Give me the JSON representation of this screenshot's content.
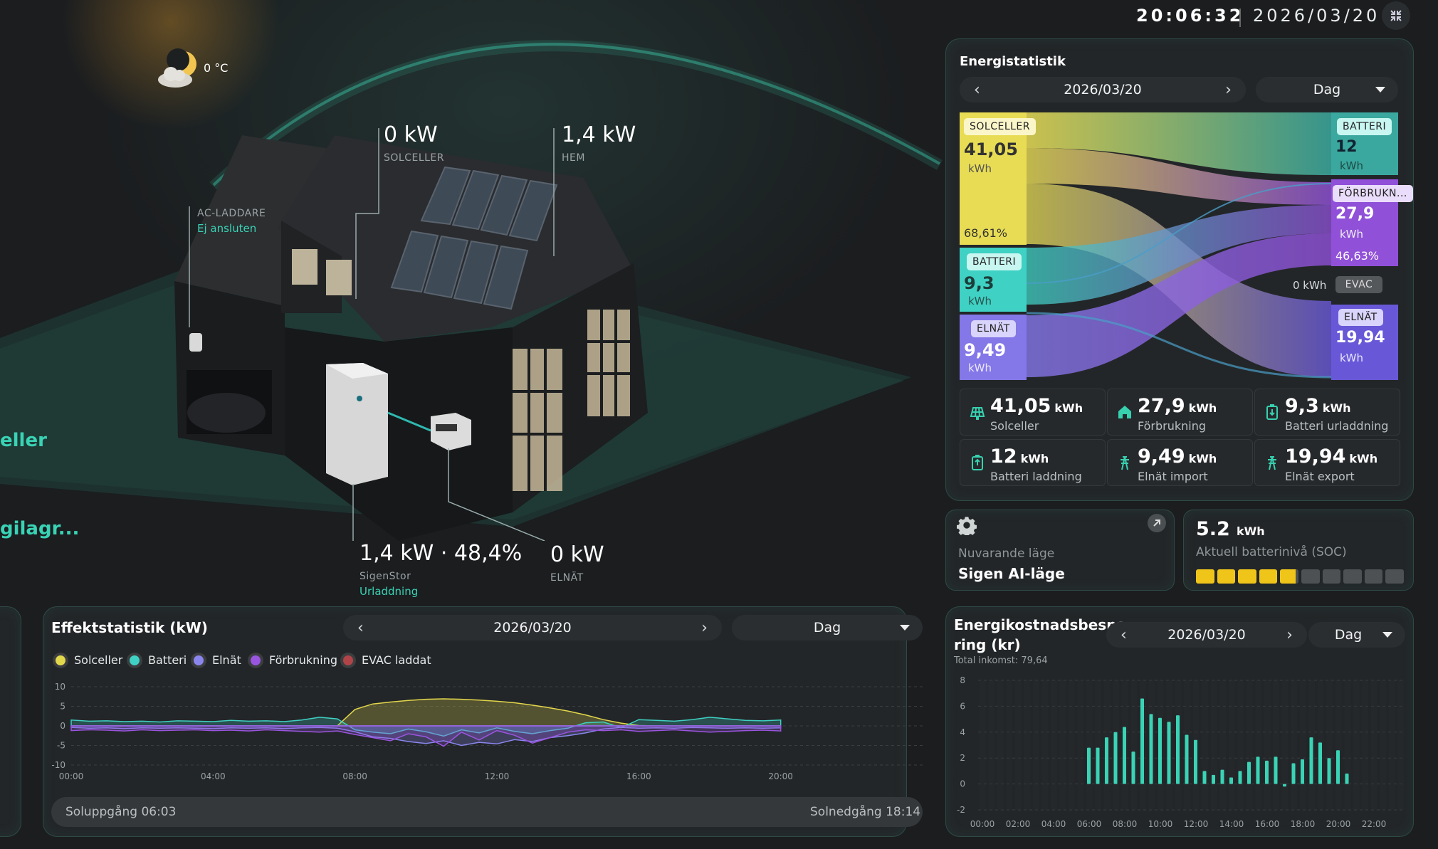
{
  "header": {
    "time": "20:06:32",
    "date": "2026/03/20"
  },
  "weather": {
    "temp": "0 °C",
    "icon": "moon-cloud-icon"
  },
  "house": {
    "solar": {
      "value": "0 kW",
      "label": "SOLCELLER"
    },
    "home": {
      "value": "1,4 kW",
      "label": "HEM"
    },
    "charger": {
      "label": "AC-LADDARE",
      "status": "Ej ansluten"
    },
    "battery": {
      "value": "1,4 kW · 48,4%",
      "label": "SigenStor",
      "status": "Urladdning"
    },
    "grid": {
      "value": "0 kW",
      "label": "ELNÄT"
    },
    "side1": "eller",
    "side2": "gilagr..."
  },
  "energy_stats": {
    "title": "Energistatistik",
    "date": "2026/03/20",
    "period": "Dag",
    "sources": [
      {
        "tag": "SOLCELLER",
        "value": "41,05",
        "unit": "kWh",
        "pct": "68,61%",
        "color": "#e8dc55"
      },
      {
        "tag": "BATTERI",
        "value": "9,3",
        "unit": "kWh",
        "color": "#3fd1c3"
      },
      {
        "tag": "ELNÄT",
        "value": "9,49",
        "unit": "kWh",
        "color": "#8477e8"
      }
    ],
    "targets": [
      {
        "tag": "BATTERI",
        "value": "12",
        "unit": "kWh",
        "color": "#3aa89e"
      },
      {
        "tag": "FÖRBRUKN...",
        "value": "27,9",
        "unit": "kWh",
        "pct": "46,63%",
        "color": "#9050d8"
      },
      {
        "tag": "EVAC",
        "value": "0 kWh",
        "color": "#4a4d50"
      },
      {
        "tag": "ELNÄT",
        "value": "19,94",
        "unit": "kWh",
        "color": "#6858d8"
      }
    ],
    "summary": [
      {
        "value": "41,05",
        "unit": "kWh",
        "label": "Solceller",
        "icon": "solar-panel-icon"
      },
      {
        "value": "27,9",
        "unit": "kWh",
        "label": "Förbrukning",
        "icon": "home-icon"
      },
      {
        "value": "9,3",
        "unit": "kWh",
        "label": "Batteri urladdning",
        "icon": "battery-discharge-icon"
      },
      {
        "value": "12",
        "unit": "kWh",
        "label": "Batteri laddning",
        "icon": "battery-charge-icon"
      },
      {
        "value": "9,49",
        "unit": "kWh",
        "label": "Elnät import",
        "icon": "grid-tower-icon"
      },
      {
        "value": "19,94",
        "unit": "kWh",
        "label": "Elnät export",
        "icon": "grid-tower-icon"
      }
    ]
  },
  "mode": {
    "label": "Nuvarande läge",
    "value": "Sigen AI-läge",
    "icon": "gear-icon"
  },
  "soc": {
    "value": "5.2",
    "unit": "kWh",
    "label": "Aktuell batterinivå (SOC)",
    "level_fraction": 0.484,
    "segments": 10
  },
  "power_stats": {
    "title": "Effektstatistik (kW)",
    "date": "2026/03/20",
    "period": "Dag",
    "legend": [
      {
        "name": "Solceller",
        "color": "#e3d74c"
      },
      {
        "name": "Batteri",
        "color": "#3fd1c3"
      },
      {
        "name": "Elnät",
        "color": "#8a86ee"
      },
      {
        "name": "Förbrukning",
        "color": "#9a55e0"
      },
      {
        "name": "EVAC laddat",
        "color": "#b04448"
      }
    ],
    "sunrise": "Soluppgång 06:03",
    "sunset": "Solnedgång 18:14"
  },
  "savings": {
    "title_line1": "Energikostnadsbespa",
    "title_line2": "ring (kr)",
    "total": "Total inkomst: 79,64",
    "date": "2026/03/20",
    "period": "Dag"
  },
  "chart_data": [
    {
      "type": "area",
      "title": "Effektstatistik (kW)",
      "ylim": [
        -10,
        10
      ],
      "yticks": [
        "10",
        "5",
        "0",
        "-5",
        "-10"
      ],
      "xticks": [
        "00:00",
        "04:00",
        "08:00",
        "12:00",
        "16:00",
        "20:00"
      ],
      "x": [
        "00:00",
        "00:30",
        "01:00",
        "01:30",
        "02:00",
        "02:30",
        "03:00",
        "03:30",
        "04:00",
        "04:30",
        "05:00",
        "05:30",
        "06:00",
        "06:30",
        "07:00",
        "07:30",
        "08:00",
        "08:30",
        "09:00",
        "09:30",
        "10:00",
        "10:30",
        "11:00",
        "11:30",
        "12:00",
        "12:30",
        "13:00",
        "13:30",
        "14:00",
        "14:30",
        "15:00",
        "15:30",
        "16:00",
        "16:30",
        "17:00",
        "17:30",
        "18:00",
        "18:30",
        "19:00",
        "19:30",
        "20:00"
      ],
      "series": [
        {
          "name": "Solceller",
          "values": [
            0,
            0,
            0,
            0,
            0,
            0,
            0,
            0,
            0,
            0,
            0,
            0,
            0,
            0,
            0,
            0,
            4.2,
            5.6,
            6.1,
            6.5,
            6.8,
            6.9,
            6.8,
            6.6,
            6.3,
            5.9,
            5.3,
            4.6,
            3.8,
            2.8,
            1.6,
            0.7,
            0.1,
            0,
            0,
            0,
            0,
            0,
            0,
            0,
            0
          ]
        },
        {
          "name": "Batteri",
          "values": [
            1.5,
            1.2,
            1.3,
            1.1,
            1.2,
            1.0,
            1.3,
            1.2,
            1.1,
            1.4,
            1.2,
            1.3,
            1.1,
            1.5,
            2.2,
            1.8,
            -1.0,
            -1.6,
            -2.0,
            -0.8,
            -1.5,
            -2.6,
            -1.0,
            -1.8,
            -0.5,
            -1.4,
            -2.0,
            -1.2,
            -0.6,
            0.8,
            1.0,
            -0.5,
            1.6,
            1.4,
            1.2,
            1.6,
            2.2,
            1.8,
            1.4,
            1.3,
            1.5
          ]
        },
        {
          "name": "Elnät",
          "values": [
            -0.4,
            -0.6,
            -0.5,
            -0.7,
            -0.5,
            -0.6,
            -0.5,
            -0.6,
            -0.7,
            -0.5,
            -0.6,
            -0.5,
            -0.7,
            -0.5,
            -0.4,
            -0.6,
            -1.5,
            -2.8,
            -3.2,
            -4.0,
            -4.5,
            -3.8,
            -5.0,
            -4.2,
            -4.6,
            -3.5,
            -4.0,
            -3.0,
            -2.5,
            -1.8,
            -0.8,
            -0.4,
            -0.6,
            -0.5,
            -0.6,
            -0.4,
            -0.5,
            -0.6,
            -0.5,
            -0.6,
            -0.5
          ]
        },
        {
          "name": "Förbrukning",
          "values": [
            -1.2,
            -1.0,
            -1.1,
            -1.3,
            -1.0,
            -1.2,
            -1.1,
            -1.0,
            -1.2,
            -1.1,
            -1.3,
            -1.0,
            -1.2,
            -1.4,
            -1.6,
            -1.3,
            -2.2,
            -3.0,
            -3.8,
            -2.0,
            -2.8,
            -5.2,
            -1.6,
            -3.6,
            -1.2,
            -2.4,
            -4.4,
            -3.0,
            -1.6,
            -1.0,
            -1.2,
            -1.0,
            -1.4,
            -1.2,
            -1.0,
            -1.3,
            -1.6,
            -1.4,
            -1.2,
            -1.1,
            -1.3
          ]
        },
        {
          "name": "EVAC laddat",
          "values": [
            0,
            0,
            0,
            0,
            0,
            0,
            0,
            0,
            0,
            0,
            0,
            0,
            0,
            0,
            0,
            0,
            0,
            0,
            0,
            0,
            0,
            0,
            0,
            0,
            0,
            0,
            0,
            0,
            0,
            0,
            0,
            0,
            0,
            0,
            0,
            0,
            0,
            0,
            0,
            0,
            0
          ]
        }
      ]
    },
    {
      "type": "bar",
      "title": "Energikostnadsbesparing (kr)",
      "ylim": [
        -2,
        8
      ],
      "yticks": [
        "8",
        "6",
        "4",
        "2",
        "0",
        "-2"
      ],
      "xticks": [
        "00:00",
        "02:00",
        "04:00",
        "06:00",
        "08:00",
        "10:00",
        "12:00",
        "14:00",
        "16:00",
        "18:00",
        "20:00",
        "22:00"
      ],
      "categories": [
        "06:00",
        "06:30",
        "07:00",
        "07:30",
        "08:00",
        "08:30",
        "09:00",
        "09:30",
        "10:00",
        "10:30",
        "11:00",
        "11:30",
        "12:00",
        "12:30",
        "13:00",
        "13:30",
        "14:00",
        "14:30",
        "15:00",
        "15:30",
        "16:00",
        "16:30",
        "17:00",
        "17:30",
        "18:00",
        "18:30",
        "19:00",
        "19:30",
        "20:00"
      ],
      "values": [
        2.8,
        2.8,
        3.6,
        4.0,
        4.4,
        2.5,
        6.6,
        5.4,
        5.1,
        4.8,
        5.3,
        3.8,
        3.4,
        1.0,
        0.7,
        1.1,
        0.5,
        1.0,
        1.7,
        2.1,
        1.8,
        2.1,
        -0.2,
        1.6,
        1.9,
        3.6,
        3.2,
        2.0,
        2.6,
        0.8
      ]
    }
  ]
}
